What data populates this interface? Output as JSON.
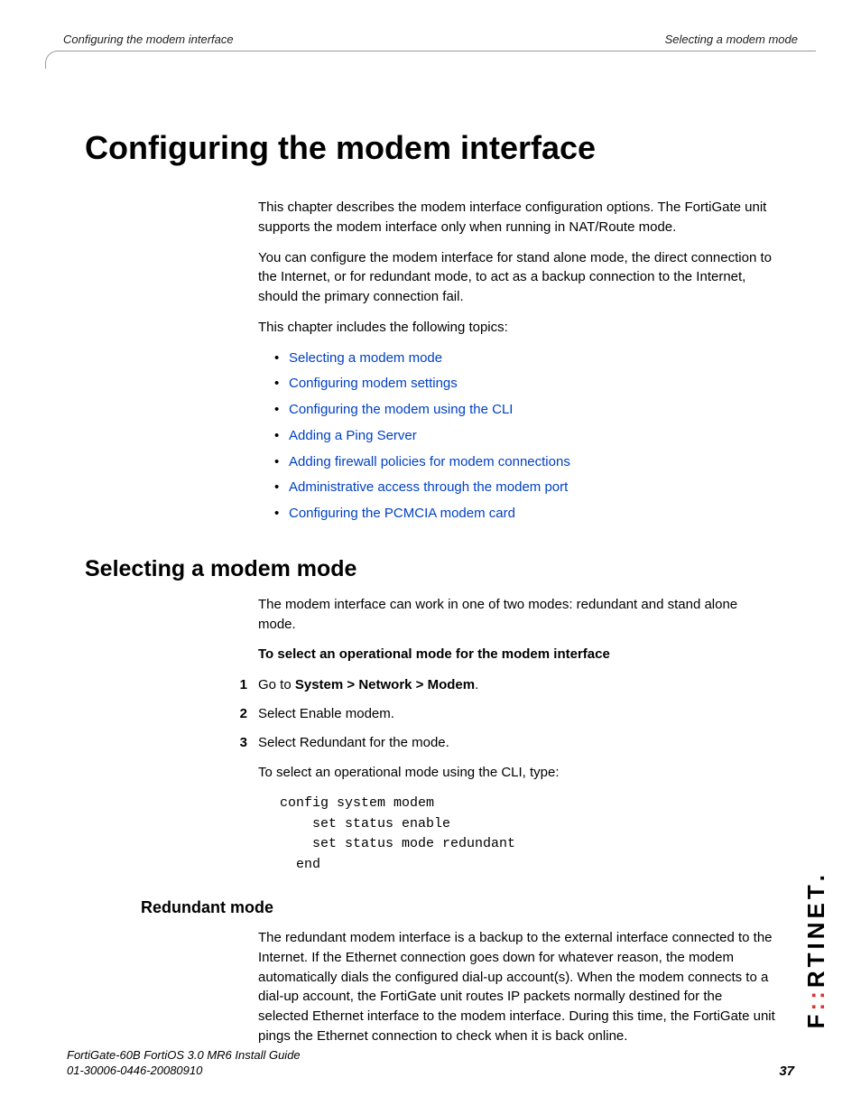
{
  "header": {
    "left": "Configuring the modem interface",
    "right": "Selecting a modem mode"
  },
  "chapter": {
    "title": "Configuring the modem interface",
    "intro": [
      "This chapter describes the modem interface configuration options. The FortiGate unit supports the modem interface only when running in NAT/Route mode.",
      "You can configure the modem interface for stand alone mode, the direct connection to the Internet, or for redundant mode, to act as a backup connection to the Internet, should the primary connection fail.",
      "This chapter includes the following topics:"
    ],
    "topics": [
      "Selecting a modem mode",
      "Configuring modem settings",
      "Configuring the modem using the CLI",
      "Adding a Ping Server",
      "Adding firewall policies for modem connections",
      "Administrative access through the modem port",
      "Configuring the PCMCIA modem card"
    ]
  },
  "section": {
    "title": "Selecting a modem mode",
    "para": "The modem interface can work in one of two modes: redundant and stand alone mode.",
    "task_title": "To select an operational mode for the modem interface",
    "steps": [
      {
        "pre": "Go to ",
        "bold": "System > Network > Modem",
        "post": "."
      },
      {
        "pre": "Select Enable modem.",
        "bold": "",
        "post": ""
      },
      {
        "pre": "Select Redundant for the mode.",
        "bold": "",
        "post": ""
      }
    ],
    "cli_intro": "To select an operational mode using the CLI, type:",
    "cli": "config system modem\n    set status enable\n    set status mode redundant\n  end"
  },
  "subsection": {
    "title": "Redundant mode",
    "body": "The redundant modem interface is a backup to the external interface connected to the Internet. If the Ethernet connection goes down for whatever reason, the modem automatically dials the configured dial-up account(s). When the modem connects to a dial-up account, the FortiGate unit routes IP packets normally destined for the selected Ethernet interface to the modem interface. During this time, the FortiGate unit pings the Ethernet connection to check when it is back online."
  },
  "footer": {
    "line1": "FortiGate-60B FortiOS 3.0 MR6 Install Guide",
    "line2": "01-30006-0446-20080910",
    "page": "37"
  },
  "brand": {
    "part1": "F",
    "accent": "::",
    "part2": "RTINET"
  }
}
